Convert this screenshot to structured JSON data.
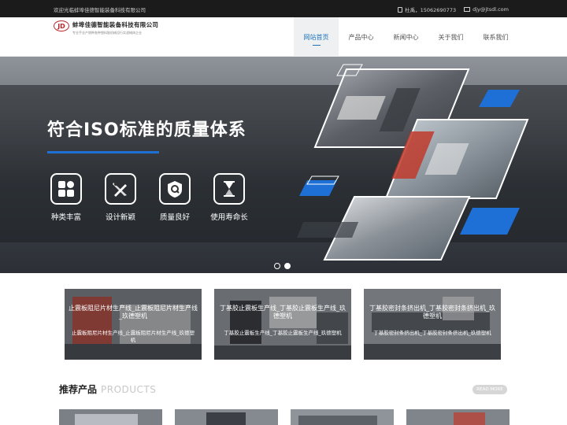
{
  "topbar": {
    "welcome": "欢迎光临蚌埠佳德智能装备科技有限公司",
    "phone": "杜禹，15062690773",
    "email": "djy@jtsdl.com"
  },
  "header": {
    "logo_mark": "JD",
    "company_name": "蚌埠佳德智能装备科技有限公司",
    "slogan": "专业手业产销种各种塑料胶机械设行实滤械体企业"
  },
  "nav": [
    {
      "label": "网站首页",
      "active": true
    },
    {
      "label": "产品中心",
      "active": false
    },
    {
      "label": "新闻中心",
      "active": false
    },
    {
      "label": "关于我们",
      "active": false
    },
    {
      "label": "联系我们",
      "active": false
    }
  ],
  "banner": {
    "headline": "符合ISO标准的质量体系",
    "features": [
      {
        "icon": "grid-icon",
        "label": "种类丰富"
      },
      {
        "icon": "design-tools-icon",
        "label": "设计新颖"
      },
      {
        "icon": "quality-shield-icon",
        "label": "质量良好"
      },
      {
        "icon": "hourglass-icon",
        "label": "使用寿命长"
      }
    ],
    "slides": 2,
    "active_slide": 2
  },
  "cards": [
    {
      "title": "止震板阻尼片材生产线_止震板阻尼片材生产线_玖德塑机",
      "subtitle": "止震板阻尼片材生产线_止震板阻尼片材生产线_玖德塑机"
    },
    {
      "title": "丁基胶止震板生产线_丁基胶止震板生产线_玖德塑机",
      "subtitle": "丁基胶止震板生产线_丁基胶止震板生产线_玖德塑机"
    },
    {
      "title": "丁基胶密封条挤出机_丁基胶密封条挤出机_玖德塑机",
      "subtitle": "丁基胶密封条挤出机_丁基胶密封条挤出机_玖德塑机"
    }
  ],
  "products_section": {
    "title_cn": "推荐产品",
    "title_en": "PRODUCTS",
    "more_label": "READ MORE"
  },
  "colors": {
    "accent": "#1e73be",
    "banner_blue": "#1e6fd6",
    "topbar": "#1b1b1b"
  }
}
